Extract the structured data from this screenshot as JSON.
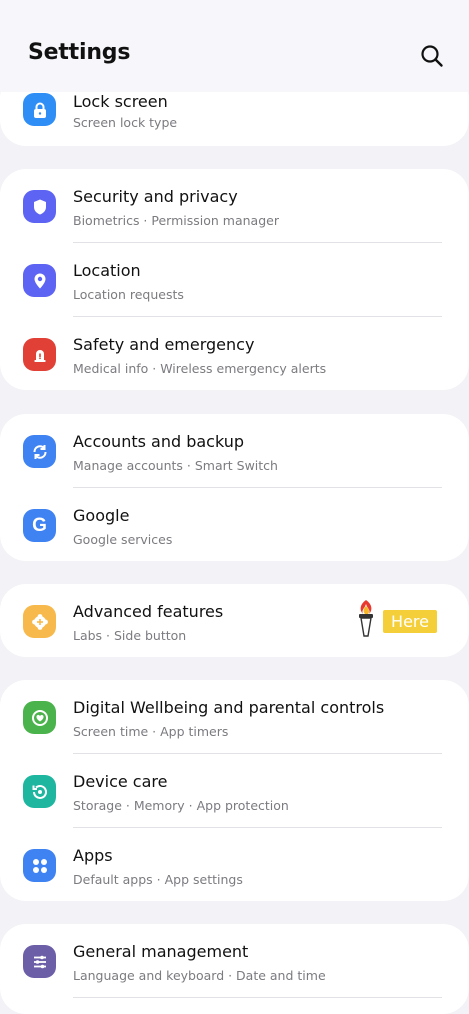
{
  "header": {
    "title": "Settings",
    "search_icon": "search-icon"
  },
  "colors": {
    "background": "#f2f2f7",
    "card": "#ffffff",
    "lock": "#2e8ef5",
    "security": "#5d63f2",
    "location": "#5d63f2",
    "safety": "#e04036",
    "accounts": "#3f82f1",
    "google": "#3f82f1",
    "advanced": "#f7b94b",
    "wellbeing": "#4bb34b",
    "device_care": "#1fb6a0",
    "apps": "#3f82f1",
    "general": "#6c5fa8",
    "here_badge": "#f5cf3a"
  },
  "groups": [
    {
      "items": [
        {
          "label": "Lock screen",
          "sub": "Screen lock type",
          "icon": "lock-icon"
        }
      ]
    },
    {
      "items": [
        {
          "label": "Security and privacy",
          "sub": "Biometrics  ·  Permission manager",
          "icon": "shield-icon"
        },
        {
          "label": "Location",
          "sub": "Location requests",
          "icon": "location-pin-icon"
        },
        {
          "label": "Safety and emergency",
          "sub": "Medical info  ·  Wireless emergency alerts",
          "icon": "emergency-icon"
        }
      ]
    },
    {
      "items": [
        {
          "label": "Accounts and backup",
          "sub": "Manage accounts  ·  Smart Switch",
          "icon": "sync-icon"
        },
        {
          "label": "Google",
          "sub": "Google services",
          "icon": "google-g-icon"
        }
      ]
    },
    {
      "items": [
        {
          "label": "Advanced features",
          "sub": "Labs  ·  Side button",
          "icon": "gear-plus-icon",
          "badge": "Here"
        }
      ]
    },
    {
      "items": [
        {
          "label": "Digital Wellbeing and parental controls",
          "sub": "Screen time  ·  App timers",
          "icon": "heart-circle-icon"
        },
        {
          "label": "Device care",
          "sub": "Storage  ·  Memory  ·  App protection",
          "icon": "refresh-circle-icon"
        },
        {
          "label": "Apps",
          "sub": "Default apps  ·  App settings",
          "icon": "apps-grid-icon"
        }
      ]
    },
    {
      "items": [
        {
          "label": "General management",
          "sub": "Language and keyboard  ·  Date and time",
          "icon": "sliders-icon"
        }
      ]
    }
  ]
}
